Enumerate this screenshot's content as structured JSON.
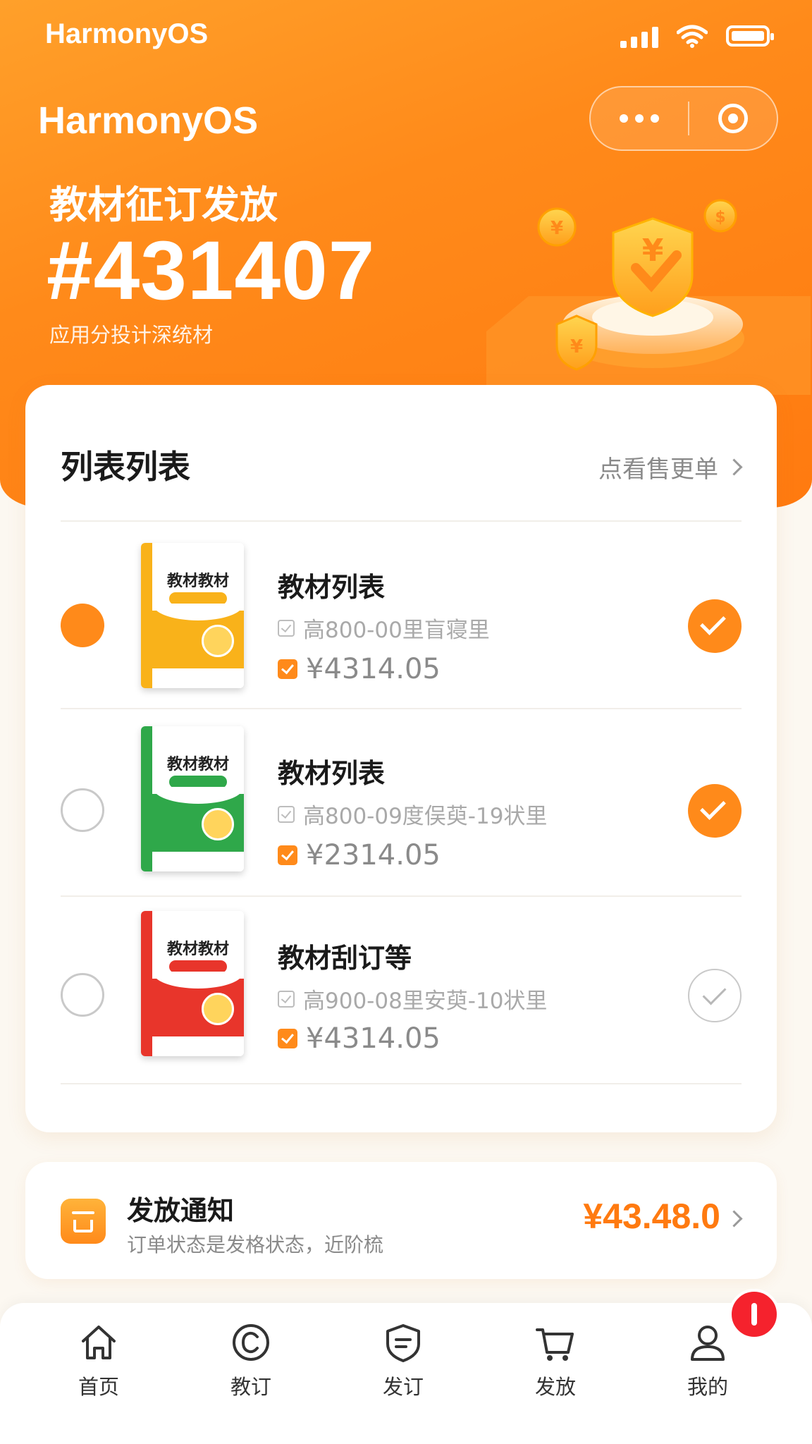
{
  "status_bar": {
    "os_name": "HarmonyOS",
    "icons": [
      "signal-icon",
      "wifi-icon",
      "battery-icon"
    ]
  },
  "header": {
    "brand": "HarmonyOS",
    "title": "教材征订发放",
    "order_no": "#431407",
    "subtitle": "应用分投计深统材",
    "capsule_icons": [
      "more-dots-icon",
      "target-icon"
    ]
  },
  "colors": {
    "accent": "#FF8A1A",
    "price": "#FF7A10",
    "badge": "#F5222D"
  },
  "list_card": {
    "title": "列表列表",
    "link_label": "点看售更单",
    "items": [
      {
        "name": "教材列表",
        "spec": "高800-00里盲寝里",
        "price": "¥4314.05",
        "selected": true,
        "checked": true,
        "cover": {
          "title": "教材教材",
          "sub": "",
          "color": "#F9B21A"
        }
      },
      {
        "name": "教材列表",
        "spec": "高800-09度俣萸-19状里",
        "price": "¥2314.05",
        "selected": false,
        "checked": true,
        "cover": {
          "title": "教材教材",
          "sub": "",
          "color": "#2FA84A"
        }
      },
      {
        "name": "教材刮订等",
        "spec": "高900-08里安萸-10状里",
        "price": "¥4314.05",
        "selected": false,
        "checked": false,
        "cover": {
          "title": "教材教材",
          "sub": "",
          "color": "#E8352B"
        }
      }
    ]
  },
  "notice": {
    "title": "发放通知",
    "desc": "订单状态是发格状态，近阶梳",
    "amount": "¥43.48.0"
  },
  "tabbar": {
    "tabs": [
      {
        "label": "首页",
        "icon": "home-icon"
      },
      {
        "label": "教订",
        "icon": "copyright-circle-icon"
      },
      {
        "label": "发订",
        "icon": "message-shield-icon"
      },
      {
        "label": "发放",
        "icon": "cart-icon"
      },
      {
        "label": "我的",
        "icon": "user-icon"
      }
    ],
    "badge_icon": "alert-badge-icon"
  }
}
